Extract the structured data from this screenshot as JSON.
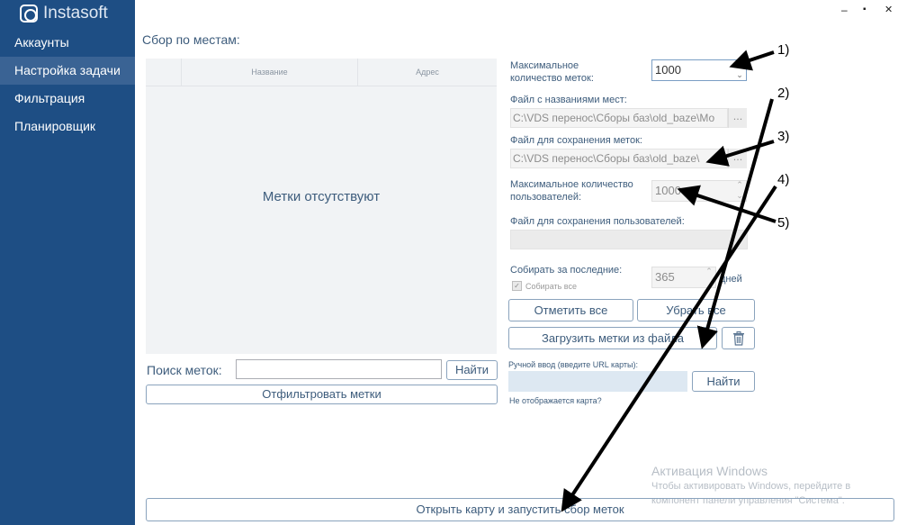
{
  "app": {
    "logo_text": "Instasoft"
  },
  "sidebar": {
    "items": [
      {
        "label": "Аккаунты"
      },
      {
        "label": "Настройка задачи"
      },
      {
        "label": "Фильтрация"
      },
      {
        "label": "Планировщик"
      }
    ],
    "active_index": 1
  },
  "window_controls": {
    "minimize": "–",
    "maximize": "▪",
    "close": "✕"
  },
  "main": {
    "section_title": "Сбор по местам:",
    "table": {
      "columns": [
        "",
        "Название",
        "Адрес"
      ],
      "empty_text": "Метки отсутствуют"
    },
    "search": {
      "label": "Поиск меток:",
      "value": "",
      "button": "Найти"
    },
    "filter_button": "Отфильтровать метки",
    "settings": {
      "max_tags_label": "Максимальное количество меток:",
      "max_tags_value": "1000",
      "places_file_label": "Файл с названиями мест:",
      "places_file_value": "C:\\VDS перенос\\Сборы баз\\old_baze\\Мо",
      "save_tags_file_label": "Файл для сохранения меток:",
      "save_tags_file_value": "C:\\VDS перенос\\Сборы баз\\old_baze\\",
      "browse_label": "...",
      "max_users_label": "Максимальное количество пользователей:",
      "max_users_value": "1000",
      "save_users_file_label": "Файл для сохранения пользователей:",
      "save_users_file_value": "",
      "collect_last_label": "Собирать за последние:",
      "collect_last_value": "365",
      "days_label": "дней",
      "collect_all_label": "Собирать все",
      "collect_all_checked": true,
      "select_all_button": "Отметить все",
      "deselect_all_button": "Убрать все",
      "load_tags_button": "Загрузить метки из файла",
      "delete_icon": "trash-icon",
      "manual_input_label": "Ручной ввод (введите URL карты):",
      "manual_input_value": "",
      "manual_find_button": "Найти",
      "map_not_shown_text": "Не отображается карта?"
    },
    "start_button": "Открыть карту и запустить сбор меток"
  },
  "watermark": {
    "title": "Активация Windows",
    "line1": "Чтобы активировать Windows, перейдите в",
    "line2": "компонент панели управления \"Система\"."
  },
  "annotations": [
    "1)",
    "2)",
    "3)",
    "4)",
    "5)"
  ],
  "colors": {
    "sidebar_bg": "#1e4e84",
    "sidebar_active": "#3a6394",
    "text_primary": "#3d5c7c",
    "button_border": "#8aa3bd",
    "arrow": "#000000"
  }
}
